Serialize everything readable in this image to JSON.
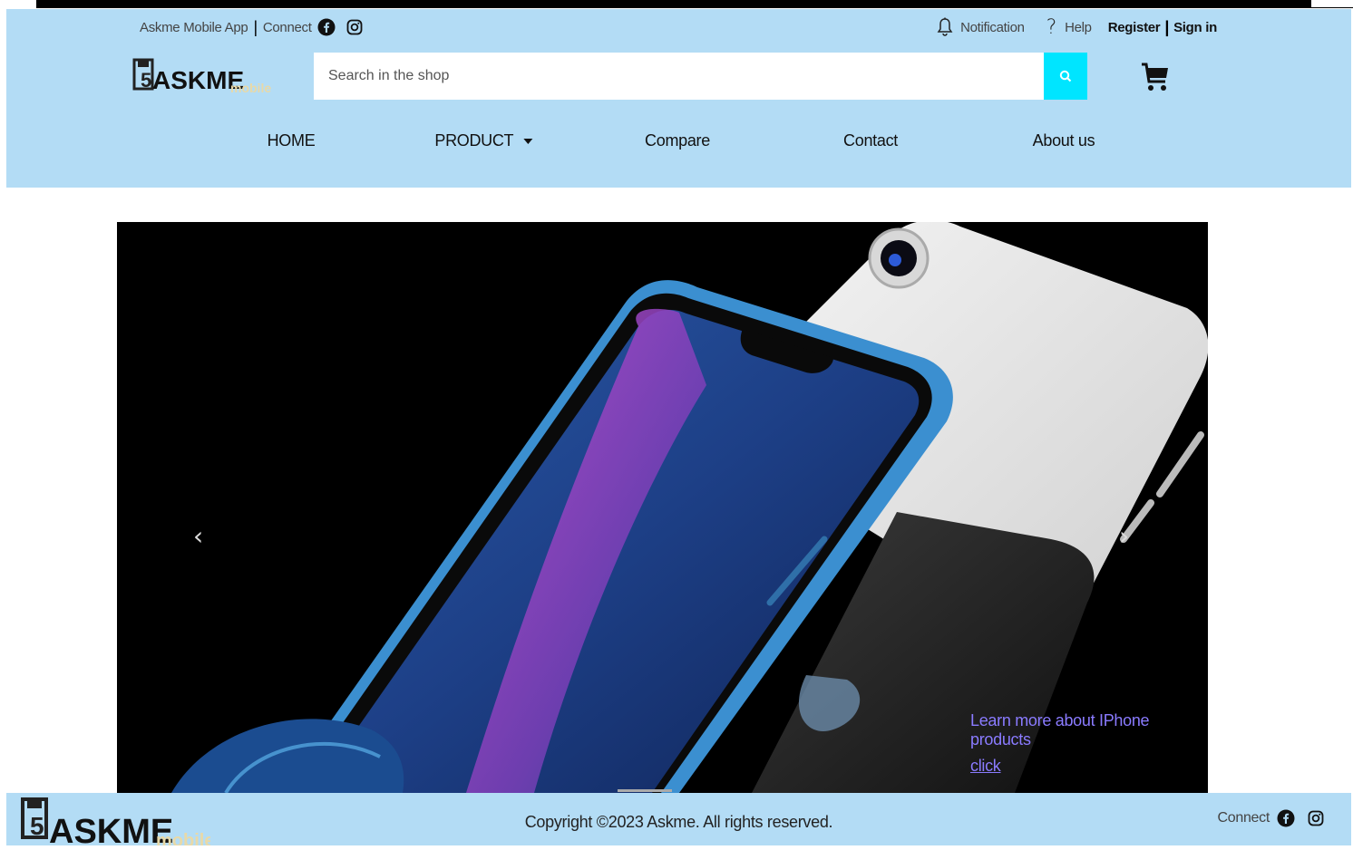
{
  "topbar": {
    "app_label": "Askme Mobile App",
    "connect_label": "Connect",
    "notification_label": "Notification",
    "help_label": "Help",
    "register_label": "Register",
    "signin_label": "Sign in"
  },
  "brand": {
    "name": "ASKME",
    "sub": "mobile"
  },
  "search": {
    "placeholder": "Search in the shop"
  },
  "nav": {
    "home": "HOME",
    "product": "PRODUCT",
    "compare": "Compare",
    "contact": "Contact",
    "about": "About us"
  },
  "carousel": {
    "prev": "‹",
    "next": "›",
    "caption_text": "Learn more about IPhone products",
    "caption_link": "click"
  },
  "footer": {
    "copyright": "Copyright ©2023 Askme. All rights reserved.",
    "connect_label": "Connect"
  },
  "colors": {
    "header_bg": "#b3dcf5",
    "accent": "#00e5ff",
    "caption": "#8a7bff"
  },
  "icons": [
    "facebook-icon",
    "instagram-icon",
    "bell-icon",
    "question-icon",
    "search-icon",
    "cart-icon",
    "caret-down-icon",
    "chevron-left-icon",
    "chevron-right-icon"
  ]
}
